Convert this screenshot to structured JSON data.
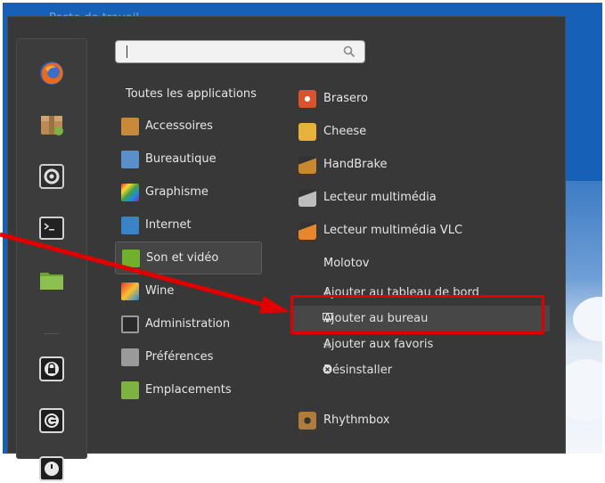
{
  "desktop": {
    "ghost_text": "Poste de travail"
  },
  "search": {
    "placeholder": ""
  },
  "favorites": [
    {
      "icon": "firefox-icon"
    },
    {
      "icon": "package-icon"
    },
    {
      "icon": "settings-icon"
    },
    {
      "icon": "terminal-icon"
    },
    {
      "icon": "folder-icon"
    },
    {
      "icon": "lock-icon"
    },
    {
      "icon": "logout-icon"
    },
    {
      "icon": "power-icon"
    }
  ],
  "categories": [
    {
      "label": "Toutes les applications",
      "icon": ""
    },
    {
      "label": "Accessoires",
      "icon": "accessories-icon",
      "color": "#c9893b"
    },
    {
      "label": "Bureautique",
      "icon": "office-icon",
      "color": "#5b8fc9"
    },
    {
      "label": "Graphisme",
      "icon": "graphics-icon",
      "color": "#d84fa0"
    },
    {
      "label": "Internet",
      "icon": "internet-icon",
      "color": "#3a83c9"
    },
    {
      "label": "Son et vidéo",
      "icon": "multimedia-icon",
      "color": "#6fb02d",
      "selected": true
    },
    {
      "label": "Wine",
      "icon": "wine-icon",
      "color": "#c23a2a"
    },
    {
      "label": "Administration",
      "icon": "administration-icon",
      "color": "#8a8a8a"
    },
    {
      "label": "Préférences",
      "icon": "preferences-icon",
      "color": "#9a9a9a"
    },
    {
      "label": "Emplacements",
      "icon": "places-icon",
      "color": "#7cb342"
    }
  ],
  "apps": [
    {
      "label": "Brasero",
      "icon": "brasero-icon",
      "color": "#d9542b"
    },
    {
      "label": "Cheese",
      "icon": "cheese-icon",
      "color": "#e6b23a"
    },
    {
      "label": "HandBrake",
      "icon": "handbrake-icon",
      "color": "#c8892e"
    },
    {
      "label": "Lecteur multimédia",
      "icon": "media-player-icon",
      "color": "#9a9a9a"
    },
    {
      "label": "Lecteur multimédia VLC",
      "icon": "vlc-icon",
      "color": "#e8862c"
    },
    {
      "label": "Molotov",
      "icon": ""
    }
  ],
  "context_menu": [
    {
      "label": "Ajouter au tableau de bord",
      "glyph": "+"
    },
    {
      "label": "Ajouter au bureau",
      "glyph": "🖵",
      "highlighted": true
    },
    {
      "label": "Ajouter aux favoris",
      "glyph": "☆"
    },
    {
      "label": "Désinstaller",
      "glyph": "●"
    }
  ],
  "rhythmbox": {
    "label": "Rhythmbox",
    "icon": "rhythmbox-icon",
    "color": "#b07c3a"
  },
  "annotation": {
    "arrow_color": "#e00000"
  }
}
